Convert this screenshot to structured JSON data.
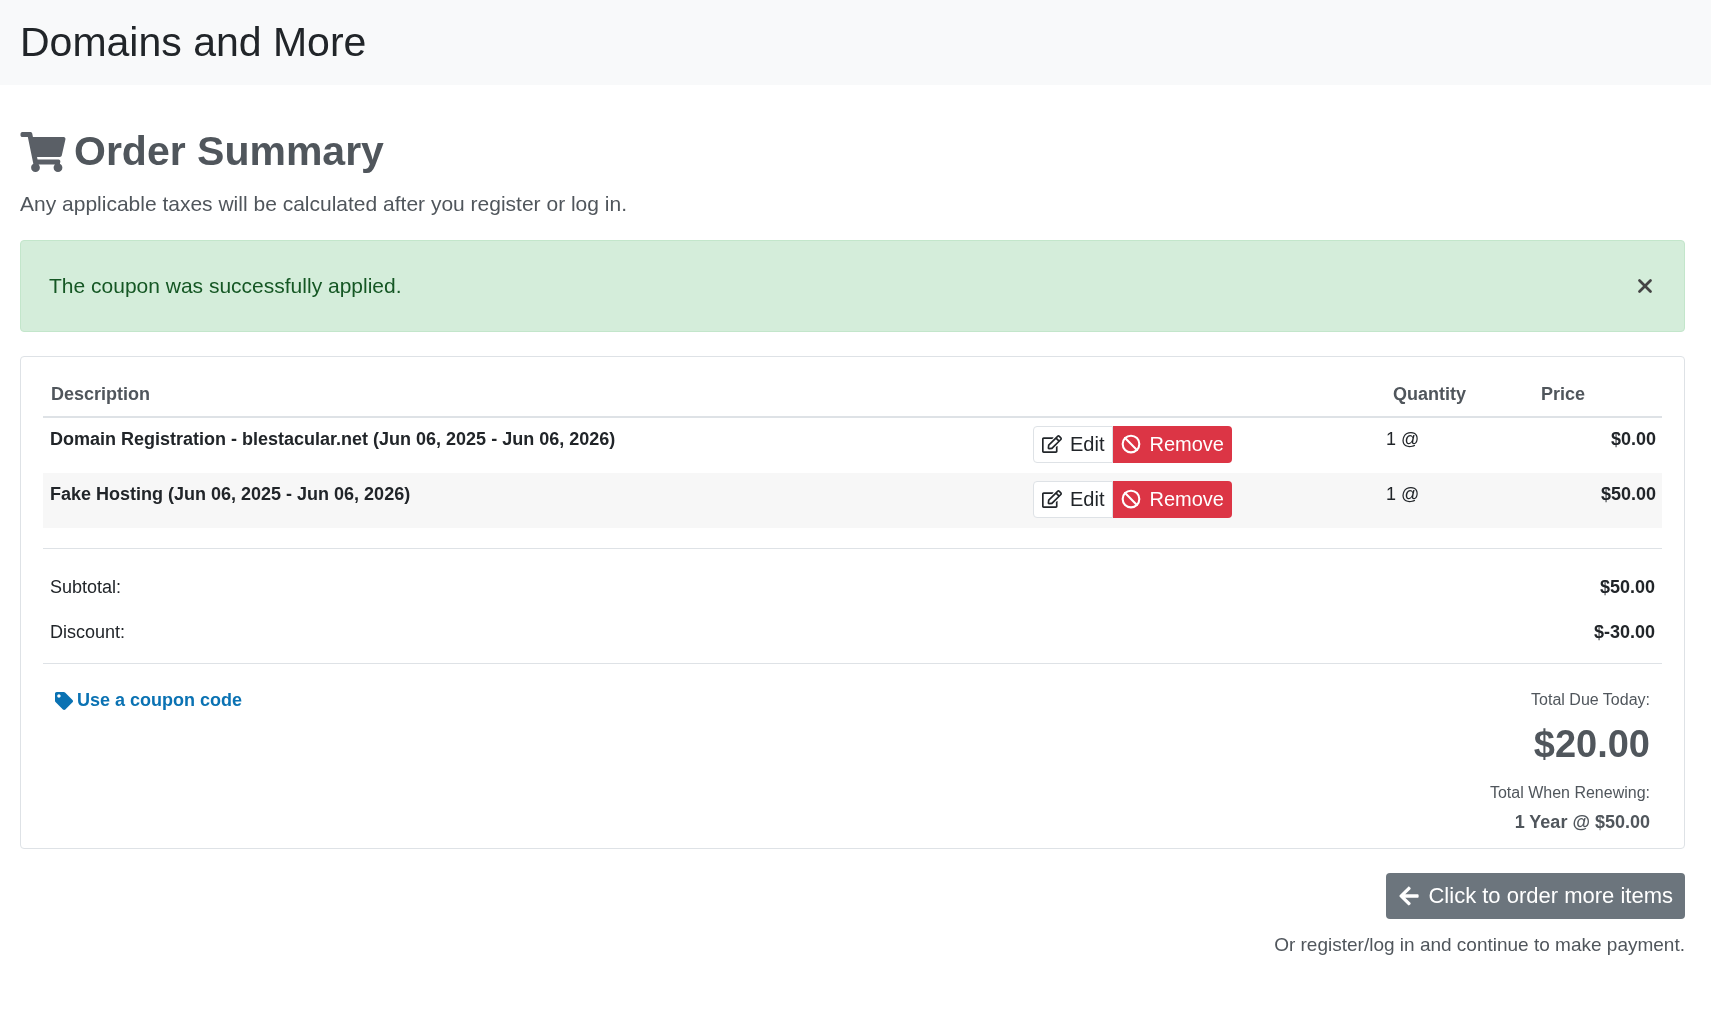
{
  "header": {
    "title": "Domains and More"
  },
  "page": {
    "title": "Order Summary",
    "subtitle": "Any applicable taxes will be calculated after you register or log in."
  },
  "alert": {
    "message": "The coupon was successfully applied."
  },
  "table": {
    "columns": [
      "Description",
      "Quantity",
      "Price"
    ],
    "rows": [
      {
        "description": "Domain Registration - blestacular.net (Jun 06, 2025 - Jun 06, 2026)",
        "edit": "Edit",
        "remove": "Remove",
        "quantity": "1 @",
        "price": "$0.00"
      },
      {
        "description": "Fake Hosting (Jun 06, 2025 - Jun 06, 2026)",
        "edit": "Edit",
        "remove": "Remove",
        "quantity": "1 @",
        "price": "$50.00"
      }
    ]
  },
  "totals": [
    {
      "label": "Subtotal:",
      "value": "$50.00"
    },
    {
      "label": "Discount:",
      "value": "$-30.00"
    }
  ],
  "coupon_link": "Use a coupon code",
  "due": {
    "label": "Total Due Today:",
    "amount": "$20.00",
    "renew_label": "Total When Renewing:",
    "renew_value": "1 Year @ $50.00"
  },
  "order_more_button": "Click to order more items",
  "footer_note": "Or register/log in and continue to make payment."
}
